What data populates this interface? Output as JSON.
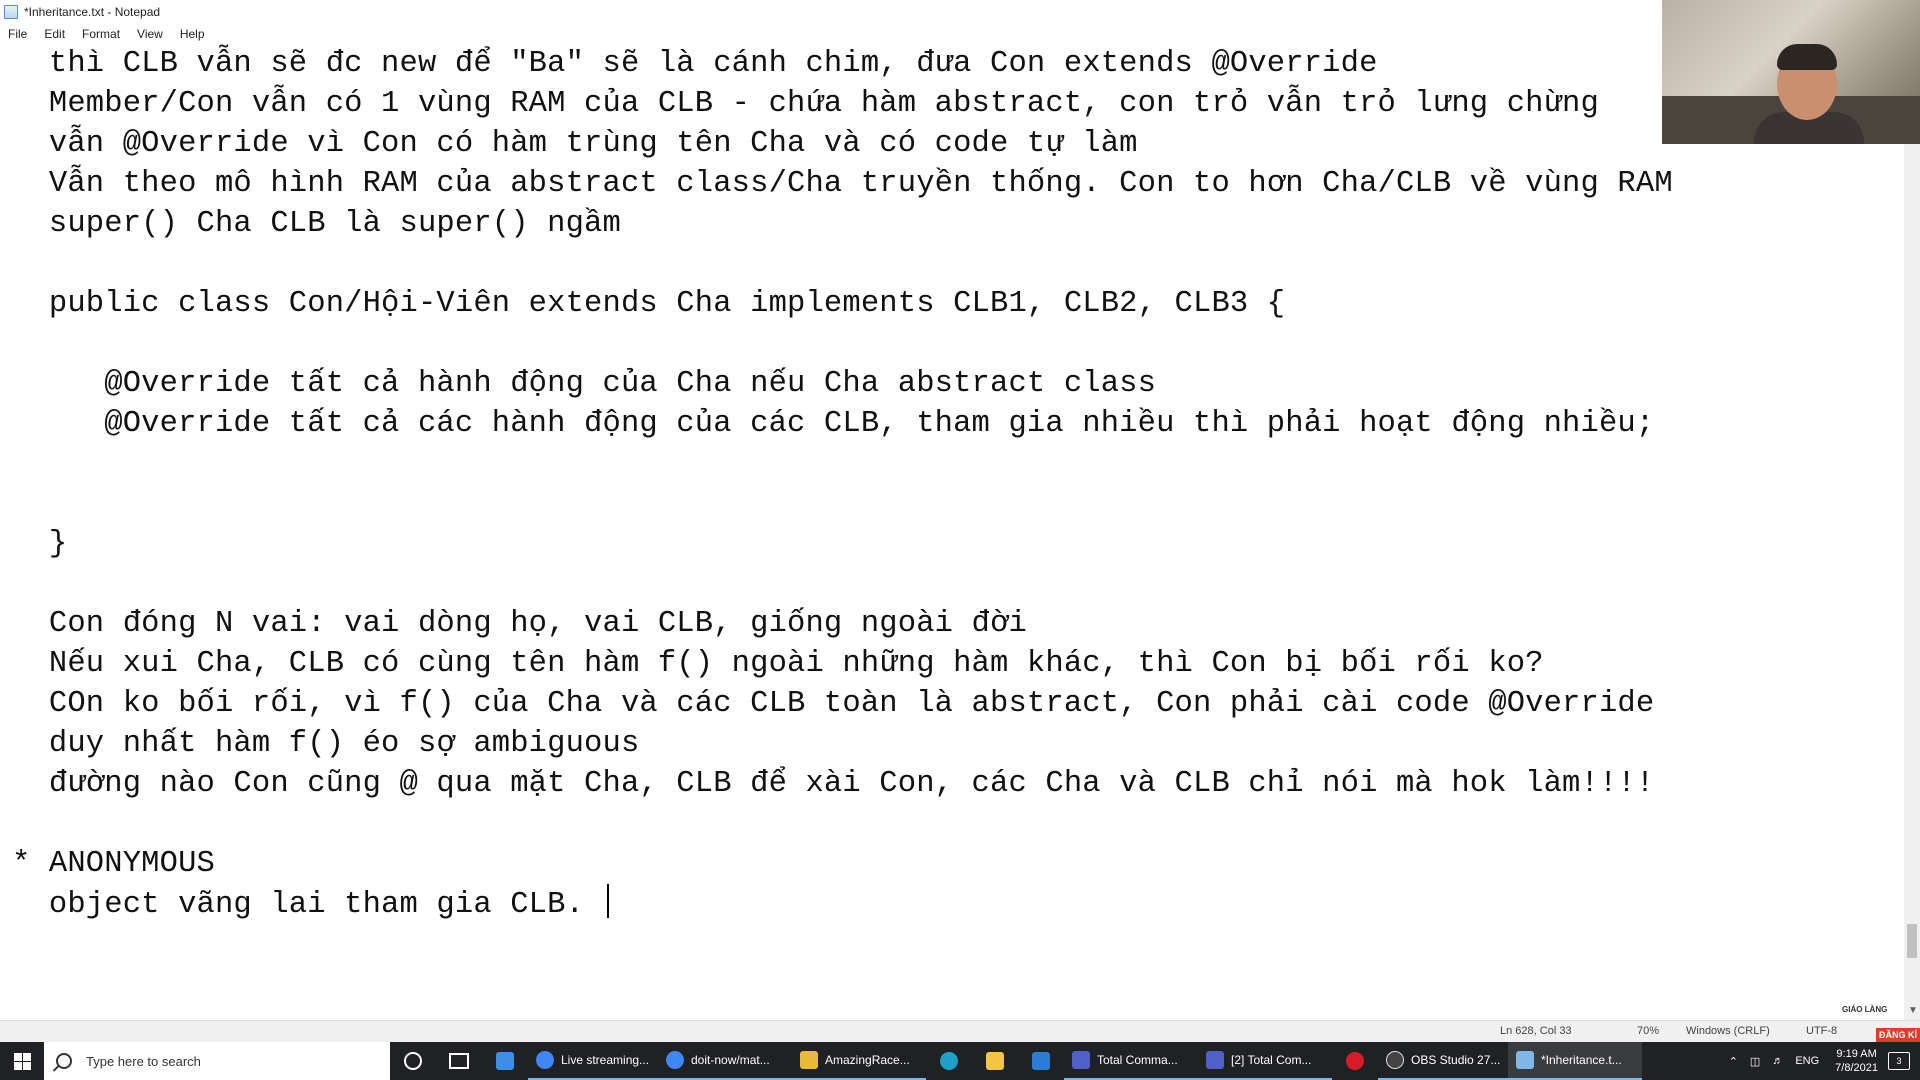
{
  "window": {
    "title": "*Inheritance.txt - Notepad"
  },
  "menu": [
    "File",
    "Edit",
    "Format",
    "View",
    "Help"
  ],
  "editor_lines": [
    {
      "text": "  thì CLB vẫn sẽ đc new để \"Ba\" sẽ là cánh chim, đưa Con extends @Override"
    },
    {
      "text": "  Member/Con vẫn có 1 vùng RAM của CLB - chứa hàm abstract, con trỏ vẫn trỏ lưng chừng"
    },
    {
      "text": "  vẫn @Override vì Con có hàm trùng tên Cha và có code tự làm"
    },
    {
      "text": "  Vẫn theo mô hình RAM của abstract class/Cha truyền thống. Con to hơn Cha/CLB về vùng RAM"
    },
    {
      "text": "  super() Cha CLB là super() ngầm"
    },
    {
      "text": ""
    },
    {
      "text": "  public class Con/Hội-Viên extends Cha implements CLB1, CLB2, CLB3 {"
    },
    {
      "text": ""
    },
    {
      "text": "     @Override tất cả hành động của Cha nếu Cha abstract class"
    },
    {
      "text": "     @Override tất cả các hành động của các CLB, tham gia nhiều thì phải hoạt động nhiều;"
    },
    {
      "text": ""
    },
    {
      "text": ""
    },
    {
      "text": "  }"
    },
    {
      "text": ""
    },
    {
      "text": "  Con đóng N vai: vai dòng họ, vai CLB, giống ngoài đời"
    },
    {
      "text": "  Nếu xui Cha, CLB có cùng tên hàm f() ngoài những hàm khác, thì Con bị bối rối ko?"
    },
    {
      "text": "  COn ko bối rối, vì f() của Cha và các CLB toàn là abstract, Con phải cài code @Override"
    },
    {
      "text": "  duy nhất hàm f() éo sợ ambiguous"
    },
    {
      "text": "  đường nào Con cũng @ qua mặt Cha, CLB để xài Con, các Cha và CLB chỉ nói mà hok làm!!!!"
    },
    {
      "text": ""
    },
    {
      "text": "* ANONYMOUS"
    },
    {
      "text": "  object vãng lai tham gia CLB. "
    }
  ],
  "statusbar": {
    "position": "Ln 628, Col 33",
    "zoom": "70%",
    "eol": "Windows (CRLF)",
    "encoding": "UTF-8"
  },
  "overlay": {
    "brand": "GIÁO LÀNG",
    "badge": "ĐĂNG KÍ"
  },
  "taskbar": {
    "search_placeholder": "Type here to search",
    "apps": [
      {
        "label": "Live streaming...",
        "icon": "chrome-icon",
        "color": "#4285f4"
      },
      {
        "label": "doit-now/mat...",
        "icon": "chrome-icon",
        "color": "#4285f4"
      },
      {
        "label": "AmazingRace...",
        "icon": "cube-icon",
        "color": "#e8b93a"
      },
      {
        "label": "Total Comma...",
        "icon": "disk-icon",
        "color": "#5060c8"
      },
      {
        "label": "[2] Total Com...",
        "icon": "disk-icon",
        "color": "#5060c8"
      },
      {
        "label": "OBS Studio 27...",
        "icon": "obs-icon",
        "color": "#444444"
      },
      {
        "label": "*Inheritance.t...",
        "icon": "notepad-icon",
        "color": "#7fb8e6"
      }
    ],
    "tray_lang": "ENG",
    "time": "9:19 AM",
    "date": "7/8/2021",
    "notifications": "3"
  }
}
